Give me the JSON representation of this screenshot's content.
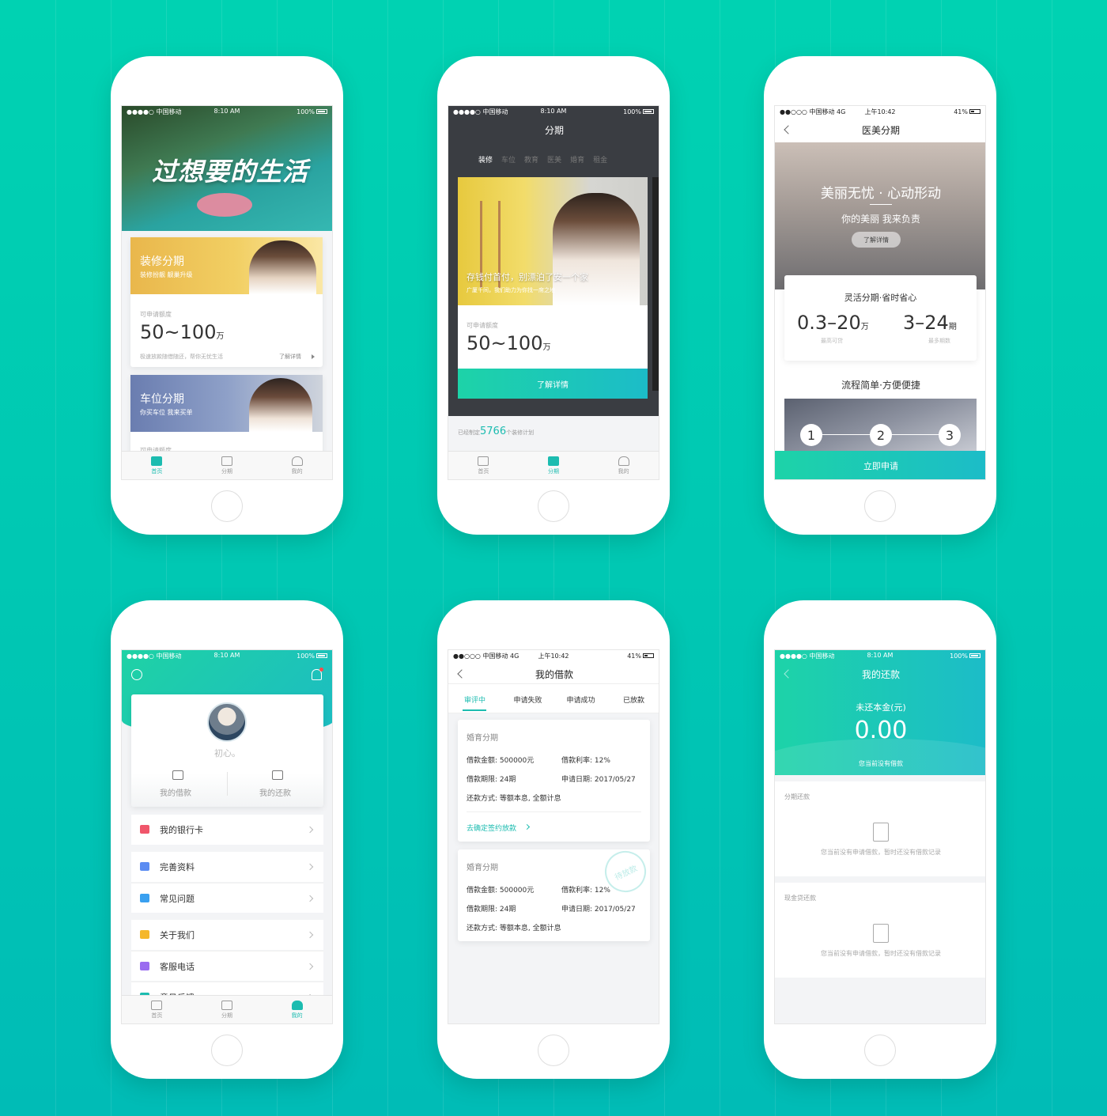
{
  "colors": {
    "background": "#00cbb3",
    "accent": "#1cbcb0",
    "dark_header": "#3a3d42"
  },
  "status": {
    "carrier_dots": "●●●●○ 中国移动",
    "time": "8:10 AM",
    "battery": "100%",
    "carrier_4g": "●●○○○ 中国移动 4G",
    "time_cn": "上午10:42",
    "battery_41": "41%"
  },
  "tabbar": {
    "home": "首页",
    "installment": "分期",
    "mine": "我的"
  },
  "phone1": {
    "hero_text": "过想要的生活",
    "card1": {
      "title": "装修分期",
      "subtitle": "装修扮靓 靓巢升级",
      "amount_label": "可申请额度",
      "amount": "50~100",
      "unit": "万",
      "note": "极速放款随借随还，帮你无忧生活",
      "link": "了解详情"
    },
    "card2": {
      "title": "车位分期",
      "subtitle": "你买车位 我来买单",
      "amount_label": "可申请额度"
    }
  },
  "phone2": {
    "title": "分期",
    "tabs": [
      "装修",
      "车位",
      "教育",
      "医美",
      "婚育",
      "租金"
    ],
    "card": {
      "headline": "存钱付首付，别漂泊了安一个家",
      "sub": "广厦千间，我们助力为你找一席之地",
      "amount_label": "可申请额度",
      "amount": "50~100",
      "unit": "万",
      "button": "了解详情"
    },
    "footer_prefix": "已经制定",
    "footer_count": "5766",
    "footer_suffix": "个装修计划"
  },
  "phone3": {
    "title": "医美分期",
    "hero_title": "美丽无忧 · 心动形动",
    "hero_sub": "你的美丽 我来负责",
    "hero_btn": "了解详情",
    "card_title": "灵活分期·省时省心",
    "amount": "0.3–20",
    "amount_unit": "万",
    "amount_label": "最高可贷",
    "term": "3–24",
    "term_unit": "期",
    "term_label": "最多期数",
    "process_title": "流程简单·方便便捷",
    "steps": [
      "1",
      "2",
      "3"
    ],
    "apply": "立即申请"
  },
  "phone4": {
    "username": "初心。",
    "my_loan": "我的借款",
    "my_repay": "我的还款",
    "menu": [
      {
        "label": "我的银行卡",
        "color": "#f0566b"
      },
      {
        "label": "完善资料",
        "color": "#5b8cf2"
      },
      {
        "label": "常见问题",
        "color": "#3aa0f0"
      },
      {
        "label": "关于我们",
        "color": "#f5b72a"
      },
      {
        "label": "客服电话",
        "color": "#9a6cf0"
      },
      {
        "label": "意见反馈",
        "color": "#1cbcb0"
      }
    ]
  },
  "phone5": {
    "title": "我的借款",
    "tabs": [
      "审评中",
      "申请失败",
      "申请成功",
      "已放款"
    ],
    "loans": [
      {
        "type": "婚育分期",
        "amount": "借款金额: 500000元",
        "rate": "借款利率: 12%",
        "term": "借款期限: 24期",
        "date": "申请日期: 2017/05/27",
        "method": "还款方式: 等额本息, 全额计息",
        "link": "去确定签约放款"
      },
      {
        "type": "婚育分期",
        "amount": "借款金额: 500000元",
        "rate": "借款利率: 12%",
        "term": "借款期限: 24期",
        "date": "申请日期: 2017/05/27",
        "method": "还款方式: 等额本息, 全额计息",
        "stamp": "待放款"
      }
    ]
  },
  "phone6": {
    "title": "我的还款",
    "principal_label": "未还本金(元)",
    "principal": "0.00",
    "no_loan": "您当前没有借款",
    "sections": [
      {
        "title": "分期还款",
        "empty": "您当前没有申请借款，暂时还没有借款记录"
      },
      {
        "title": "现金贷还款",
        "empty": "您当前没有申请借款，暂时还没有借款记录"
      }
    ]
  }
}
